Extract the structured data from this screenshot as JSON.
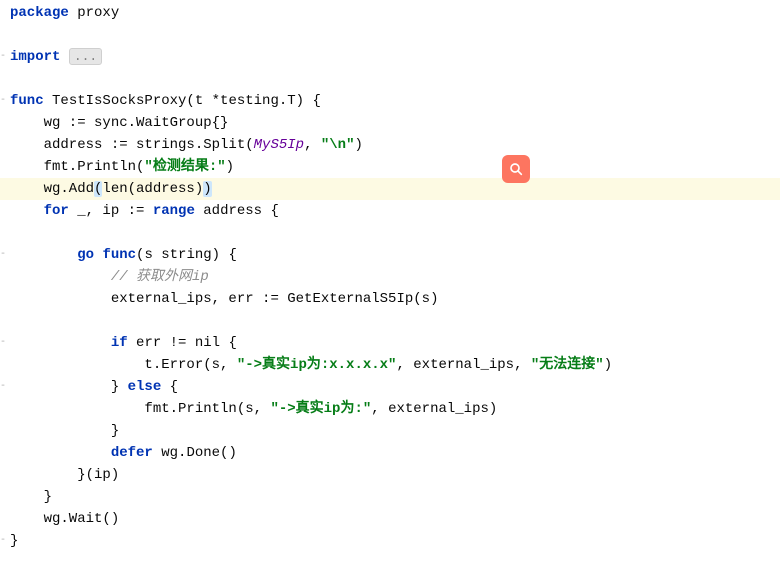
{
  "code": {
    "package_kw": "package",
    "package_name": " proxy",
    "import_kw": "import",
    "import_fold": "...",
    "func_kw": "func",
    "func_sig_1": " TestIsSocksProxy(t *testing.T) {",
    "line_wg_decl": "    wg := sync.WaitGroup{}",
    "line_addr_1": "    address := strings.Split(",
    "line_addr_param": "MyS5Ip",
    "line_addr_2": ", ",
    "line_addr_str": "\"\\n\"",
    "line_addr_3": ")",
    "line_println_1": "    fmt.Println(",
    "line_println_str": "\"检测结果:\"",
    "line_println_2": ")",
    "line_wgadd_1": "    wg.Add",
    "line_wgadd_p1": "(",
    "line_wgadd_2": "len(address)",
    "line_wgadd_p2": ")",
    "for_kw": "for",
    "line_for_1": " _, ip := ",
    "range_kw": "range",
    "line_for_2": " address {",
    "go_kw": "go",
    "func2_kw": "func",
    "line_gofunc": "(s string) {",
    "comment_getip": "// 获取外网ip",
    "line_extips": "            external_ips, err := GetExternalS5Ip(s)",
    "if_kw": "if",
    "line_if_cond": " err != nil {",
    "line_terror_1": "                t.Error(s, ",
    "line_terror_str1": "\"->真实ip为:x.x.x.x\"",
    "line_terror_2": ", external_ips, ",
    "line_terror_str2": "\"无法连接\"",
    "line_terror_3": ")",
    "line_else_1": "            } ",
    "else_kw": "else",
    "line_else_2": " {",
    "line_println2_1": "                fmt.Println(s, ",
    "line_println2_str": "\"->真实ip为:\"",
    "line_println2_2": ", external_ips)",
    "line_close1": "            }",
    "defer_kw": "defer",
    "line_defer": " wg.Done()",
    "line_close2": "        }(ip)",
    "line_close3": "    }",
    "line_wait": "    wg.Wait()",
    "line_close4": "}"
  },
  "icons": {
    "search": "search-icon"
  }
}
